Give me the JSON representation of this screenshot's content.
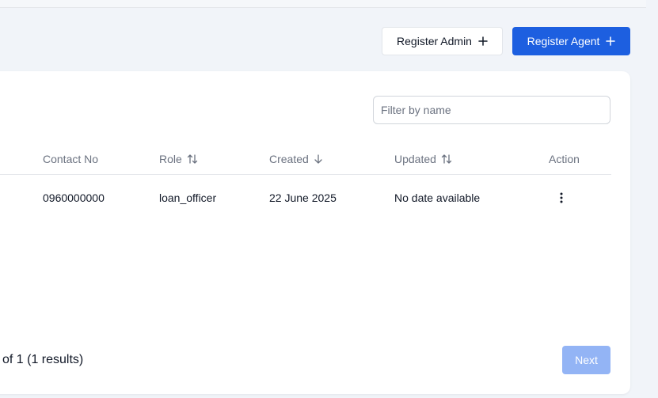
{
  "toolbar": {
    "register_admin_label": "Register Admin",
    "register_agent_label": "Register Agent"
  },
  "filter": {
    "placeholder": "Filter by name",
    "value": ""
  },
  "table": {
    "columns": [
      "Contact No",
      "Role",
      "Created",
      "Updated",
      "Action"
    ],
    "rows": [
      {
        "contact_no": "0960000000",
        "role": "loan_officer",
        "created": "22 June 2025",
        "updated": "No date available"
      }
    ]
  },
  "pagination": {
    "results_text": "of 1 (1 results)",
    "next_label": "Next"
  },
  "colors": {
    "primary": "#1d5fe0",
    "primary_disabled": "#93b4f5",
    "background": "#f1f4f9"
  }
}
